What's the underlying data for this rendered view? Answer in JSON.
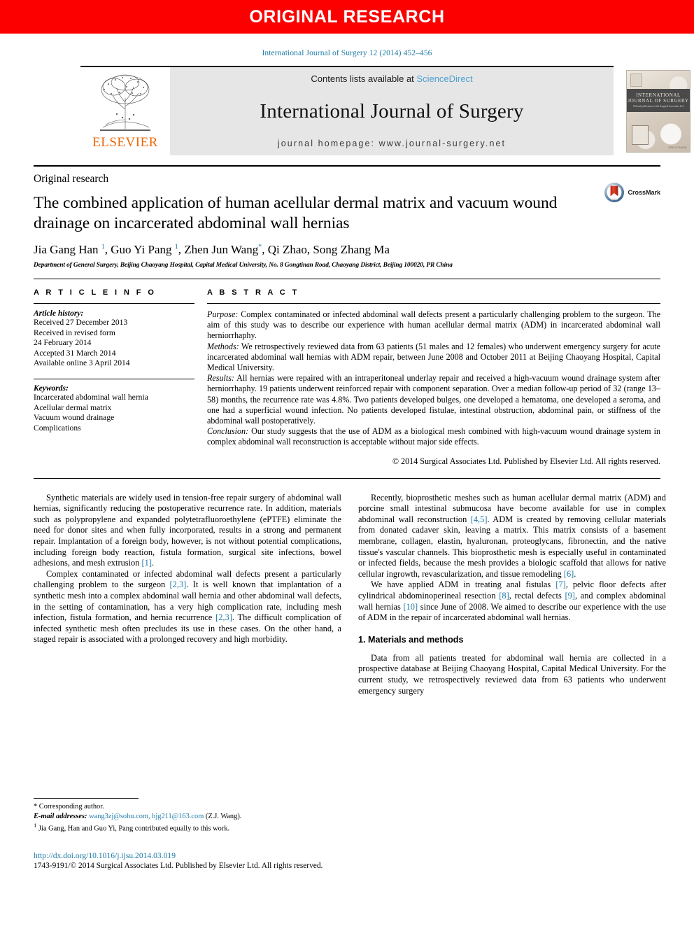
{
  "banner": {
    "label": "ORIGINAL RESEARCH"
  },
  "running_citation": "International Journal of Surgery 12 (2014) 452–456",
  "masthead": {
    "contents_prefix": "Contents lists available at ",
    "sciencedirect": "ScienceDirect",
    "journal_title": "International Journal of Surgery",
    "homepage": "journal homepage: www.journal-surgery.net",
    "publisher_name": "ELSEVIER",
    "cover": {
      "title_line1": "INTERNATIONAL",
      "title_line2": "JOURNAL OF SURGERY",
      "subtitle": "Official publication of the\nSurgical Associates Ltd",
      "issn": "ISSN 1743-9191"
    }
  },
  "article": {
    "kind": "Original research",
    "title": "The combined application of human acellular dermal matrix and vacuum wound drainage on incarcerated abdominal wall hernias",
    "authors_html": "Jia Gang Han <sup>1</sup>, Guo Yi Pang <sup>1</sup>, Zhen Jun Wang<sup>*</sup>, Qi Zhao, Song Zhang Ma",
    "affiliation": "Department of General Surgery, Beijing Chaoyang Hospital, Capital Medical University, No. 8 Gongtinan Road, Chaoyang District, Beijing 100020, PR China",
    "crossmark_label": "CrossMark"
  },
  "article_info": {
    "heading": "A R T I C L E   I N F O",
    "history_heading": "Article history:",
    "history": [
      "Received 27 December 2013",
      "Received in revised form",
      "24 February 2014",
      "Accepted 31 March 2014",
      "Available online 3 April 2014"
    ],
    "keywords_heading": "Keywords:",
    "keywords": [
      "Incarcerated abdominal wall hernia",
      "Acellular dermal matrix",
      "Vacuum wound drainage",
      "Complications"
    ]
  },
  "abstract": {
    "heading": "A B S T R A C T",
    "sections": [
      {
        "label": "Purpose:",
        "text": " Complex contaminated or infected abdominal wall defects present a particularly challenging problem to the surgeon. The aim of this study was to describe our experience with human acellular dermal matrix (ADM) in incarcerated abdominal wall herniorrhaphy."
      },
      {
        "label": "Methods:",
        "text": " We retrospectively reviewed data from 63 patients (51 males and 12 females) who underwent emergency surgery for acute incarcerated abdominal wall hernias with ADM repair, between June 2008 and October 2011 at Beijing Chaoyang Hospital, Capital Medical University."
      },
      {
        "label": "Results:",
        "text": " All hernias were repaired with an intraperitoneal underlay repair and received a high-vacuum wound drainage system after herniorrhaphy. 19 patients underwent reinforced repair with component separation. Over a median follow-up period of 32 (range 13–58) months, the recurrence rate was 4.8%. Two patients developed bulges, one developed a hematoma, one developed a seroma, and one had a superficial wound infection. No patients developed fistulae, intestinal obstruction, abdominal pain, or stiffness of the abdominal wall postoperatively."
      },
      {
        "label": "Conclusion:",
        "text": " Our study suggests that the use of ADM as a biological mesh combined with high-vacuum wound drainage system in complex abdominal wall reconstruction is acceptable without major side effects."
      }
    ],
    "copyright": "© 2014 Surgical Associates Ltd. Published by Elsevier Ltd. All rights reserved."
  },
  "body": {
    "left_column": [
      {
        "html": "Synthetic materials are widely used in tension-free repair surgery of abdominal wall hernias, significantly reducing the postoperative recurrence rate. In addition, materials such as polypropylene and expanded polytetrafluoroethylene (ePTFE) eliminate the need for donor sites and when fully incorporated, results in a strong and permanent repair. Implantation of a foreign body, however, is not without potential complications, including foreign body reaction, fistula formation, surgical site infections, bowel adhesions, and mesh extrusion <span class=\"ref\">[1]</span>."
      },
      {
        "html": "Complex contaminated or infected abdominal wall defects present a particularly challenging problem to the surgeon <span class=\"ref\">[2,3]</span>. It is well known that implantation of a synthetic mesh into a complex abdominal wall hernia and other abdominal wall defects, in the setting of contamination, has a very high complication rate, including mesh infection, fistula formation, and hernia recurrence <span class=\"ref\">[2,3]</span>. The difficult complication of infected synthetic mesh often precludes its use in these cases. On the other hand, a staged repair is associated with a prolonged recovery and high morbidity."
      }
    ],
    "right_column": [
      {
        "html": "Recently, bioprosthetic meshes such as human acellular dermal matrix (ADM) and porcine small intestinal submucosa have become available for use in complex abdominal wall reconstruction <span class=\"ref\">[4,5]</span>. ADM is created by removing cellular materials from donated cadaver skin, leaving a matrix. This matrix consists of a basement membrane, collagen, elastin, hyaluronan, proteoglycans, fibronectin, and the native tissue's vascular channels. This bioprosthetic mesh is especially useful in contaminated or infected fields, because the mesh provides a biologic scaffold that allows for native cellular ingrowth, revascularization, and tissue remodeling <span class=\"ref\">[6]</span>."
      },
      {
        "html": "We have applied ADM in treating anal fistulas <span class=\"ref\">[7]</span>, pelvic floor defects after cylindrical abdominoperineal resection <span class=\"ref\">[8]</span>, rectal defects <span class=\"ref\">[9]</span>, and complex abdominal wall hernias <span class=\"ref\">[10]</span> since June of 2008. We aimed to describe our experience with the use of ADM in the repair of incarcerated abdominal wall hernias."
      }
    ],
    "section_heading": "1.  Materials and methods",
    "section_paragraphs": [
      {
        "html": "Data from all patients treated for abdominal wall hernia are collected in a prospective database at Beijing Chaoyang Hospital, Capital Medical University. For the current study, we retrospectively reviewed data from 63 patients who underwent emergency surgery"
      }
    ]
  },
  "footnotes": {
    "corresponding": "* Corresponding author.",
    "email_label": "E-mail addresses:",
    "emails": "wang3zj@sohu.com, hjg211@163.com",
    "email_suffix": " (Z.J. Wang).",
    "equal_marker": "1",
    "equal_contrib": "Jia Gang, Han and Guo Yi, Pang contributed equally to this work."
  },
  "doi_block": {
    "doi_url": "http://dx.doi.org/10.1016/j.ijsu.2014.03.019",
    "issn_line": "1743-9191/© 2014 Surgical Associates Ltd. Published by Elsevier Ltd. All rights reserved."
  },
  "colors": {
    "banner_red": "#fc0000",
    "link_blue": "#1e7ba6",
    "sciencedirect_blue": "#4f9fd0",
    "elsevier_orange": "#ec6707",
    "masthead_gray": "#e6e6e6"
  }
}
